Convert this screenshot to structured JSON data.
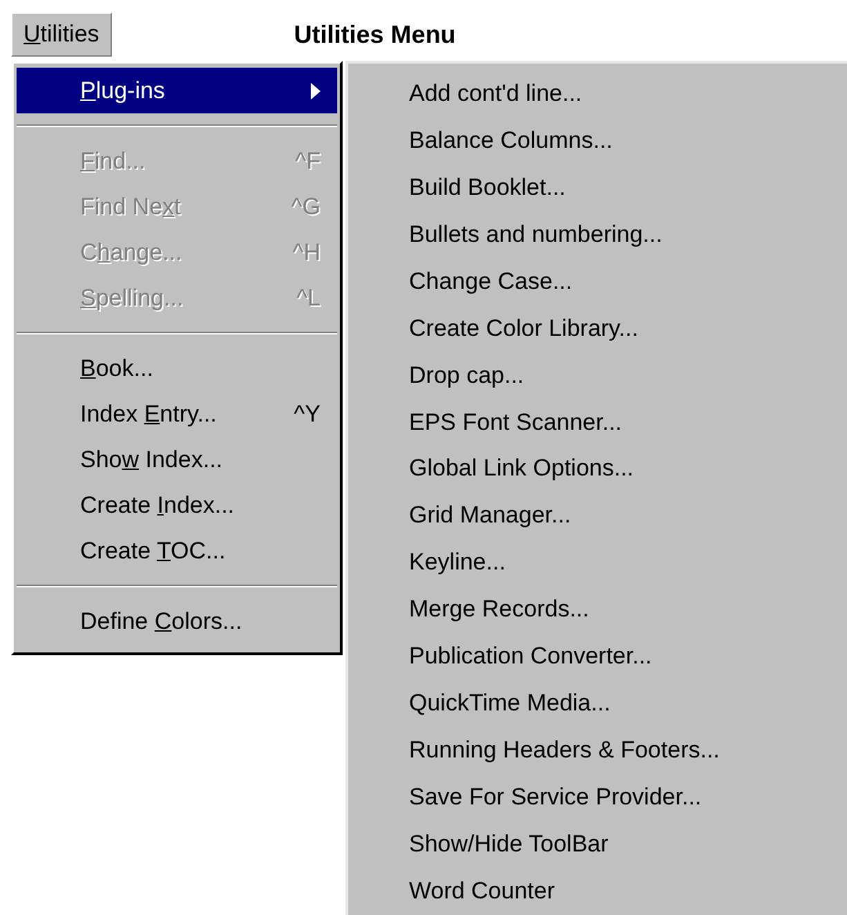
{
  "menu_bar": {
    "label": [
      {
        "text": "U",
        "underlined": true
      },
      {
        "text": "tilities",
        "underlined": false
      }
    ],
    "selected": false
  },
  "title": "Utilities Menu",
  "menu": {
    "items": [
      {
        "kind": "item",
        "label": [
          {
            "text": "P",
            "underlined": true
          },
          {
            "text": "lug-ins",
            "underlined": false
          }
        ],
        "disabled": false,
        "selected": true,
        "submenu": true
      },
      {
        "kind": "separator"
      },
      {
        "kind": "item",
        "label": [
          {
            "text": "F",
            "underlined": true
          },
          {
            "text": "ind...",
            "underlined": false
          }
        ],
        "shortcut": "^F",
        "disabled": true,
        "selected": false
      },
      {
        "kind": "item",
        "label": [
          {
            "text": "Find Ne",
            "underlined": false
          },
          {
            "text": "x",
            "underlined": true
          },
          {
            "text": "t",
            "underlined": false
          }
        ],
        "shortcut": "^G",
        "disabled": true,
        "selected": false
      },
      {
        "kind": "item",
        "label": [
          {
            "text": "C",
            "underlined": false
          },
          {
            "text": "h",
            "underlined": true
          },
          {
            "text": "ange...",
            "underlined": false
          }
        ],
        "shortcut": "^H",
        "disabled": true,
        "selected": false
      },
      {
        "kind": "item",
        "label": [
          {
            "text": "S",
            "underlined": true
          },
          {
            "text": "pelling...",
            "underlined": false
          }
        ],
        "shortcut": "^L",
        "disabled": true,
        "selected": false
      },
      {
        "kind": "separator"
      },
      {
        "kind": "item",
        "label": [
          {
            "text": "B",
            "underlined": true
          },
          {
            "text": "ook...",
            "underlined": false
          }
        ],
        "disabled": false,
        "selected": false
      },
      {
        "kind": "item",
        "label": [
          {
            "text": "Index ",
            "underlined": false
          },
          {
            "text": "E",
            "underlined": true
          },
          {
            "text": "ntry...",
            "underlined": false
          }
        ],
        "shortcut": "^Y",
        "disabled": false,
        "selected": false
      },
      {
        "kind": "item",
        "label": [
          {
            "text": "Sho",
            "underlined": false
          },
          {
            "text": "w",
            "underlined": true
          },
          {
            "text": " Index...",
            "underlined": false
          }
        ],
        "disabled": false,
        "selected": false
      },
      {
        "kind": "item",
        "label": [
          {
            "text": "Create ",
            "underlined": false
          },
          {
            "text": "I",
            "underlined": true
          },
          {
            "text": "ndex...",
            "underlined": false
          }
        ],
        "disabled": false,
        "selected": false
      },
      {
        "kind": "item",
        "label": [
          {
            "text": "Create ",
            "underlined": false
          },
          {
            "text": "T",
            "underlined": true
          },
          {
            "text": "OC...",
            "underlined": false
          }
        ],
        "disabled": false,
        "selected": false
      },
      {
        "kind": "separator"
      },
      {
        "kind": "item",
        "label": [
          {
            "text": "Define ",
            "underlined": false
          },
          {
            "text": "C",
            "underlined": true
          },
          {
            "text": "olors...",
            "underlined": false
          }
        ],
        "disabled": false,
        "selected": false
      }
    ]
  },
  "submenu": {
    "items": [
      "Add cont'd line...",
      "Balance Columns...",
      "Build Booklet...",
      "Bullets and numbering...",
      "Change Case...",
      "Create Color Library...",
      "Drop cap...",
      "EPS Font Scanner...",
      "Global Link Options...",
      "Grid Manager...",
      "Keyline...",
      "Merge Records...",
      "Publication Converter...",
      "QuickTime Media...",
      "Running Headers & Footers...",
      "Save For Service Provider...",
      "Show/Hide ToolBar",
      "Word Counter"
    ]
  }
}
